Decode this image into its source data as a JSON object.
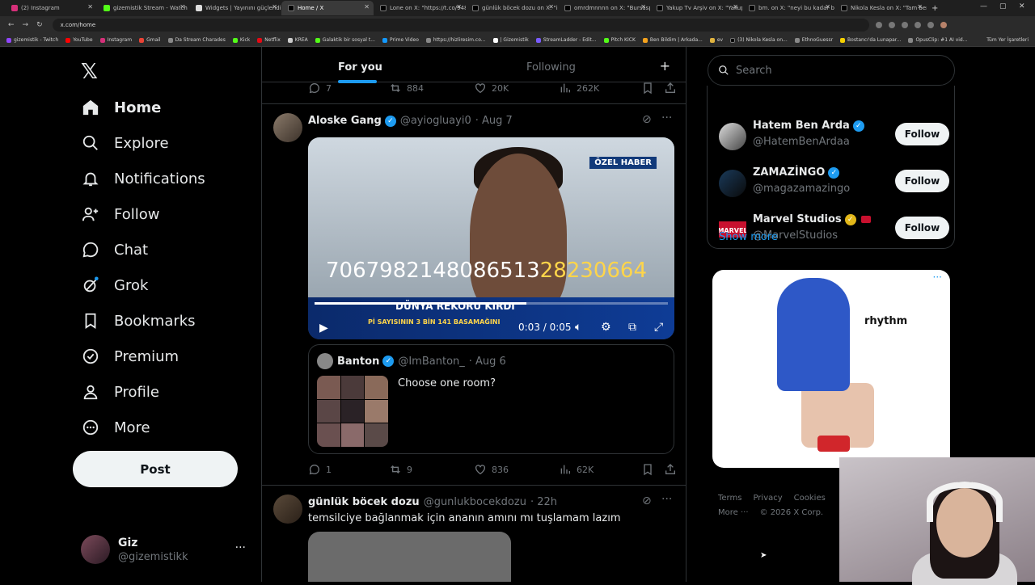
{
  "browser": {
    "tabs": [
      "(2) Instagram",
      "gizemistik Stream - Watch Li",
      "Widgets | Yayınını güçlendir",
      "Home / X",
      "Lone on X: \"https://t.co/948",
      "günlük böcek dozu on X: \"iny",
      "omrdmnnnn on X: \"Bursaspo",
      "Yakup Tv Arşiv on X: \"Yakup T",
      "bm. on X: \"neyi bu kadar büyü",
      "Nikola Kesla on X: \"Tam ben"
    ],
    "active_tab": 3,
    "url": "x.com/home",
    "bookmarks": [
      "gizemistik - Twitch",
      "YouTube",
      "Instagram",
      "Gmail",
      "Da Stream Charades",
      "Kick",
      "Netflix",
      "KREA",
      "Galaktik bir sosyal t...",
      "Prime Video",
      "https://hizliresim.co...",
      "| Gizemistik",
      "StreamLadder - Edit...",
      "Pitch KICK",
      "Ben Bildim | Arkada...",
      "ev",
      "(3) Nikola Kesla on...",
      "EthnoGuessr",
      "Bostancı'da Lunapar...",
      "OpusClip: #1 AI vid..."
    ],
    "bookmarks_right": "Tüm Yer İşaretleri"
  },
  "nav": {
    "items": [
      {
        "label": "Home",
        "icon": "home-icon"
      },
      {
        "label": "Explore",
        "icon": "search-icon"
      },
      {
        "label": "Notifications",
        "icon": "bell-icon"
      },
      {
        "label": "Follow",
        "icon": "follow-icon"
      },
      {
        "label": "Chat",
        "icon": "chat-icon"
      },
      {
        "label": "Grok",
        "icon": "grok-icon"
      },
      {
        "label": "Bookmarks",
        "icon": "bookmark-icon"
      },
      {
        "label": "Premium",
        "icon": "premium-icon"
      },
      {
        "label": "Profile",
        "icon": "profile-icon"
      },
      {
        "label": "More",
        "icon": "more-icon"
      }
    ],
    "post_label": "Post",
    "account": {
      "name": "Giz",
      "handle": "@gizemistikk"
    }
  },
  "feed": {
    "tabs": [
      "For you",
      "Following"
    ],
    "top_actions": {
      "replies": "7",
      "reposts": "884",
      "likes": "20K",
      "views": "262K"
    },
    "post1": {
      "name": "Aloske Gang",
      "handle": "@ayiogluayi0",
      "date": "· Aug 7",
      "video": {
        "badge": "ÖZEL HABER",
        "number_a": "7067982148086513",
        "number_b": "28230664",
        "headline": "DÜNYA REKORU KIRDI",
        "subline": "Pİ SAYISININ 3 BİN 141 BASAMAĞINI",
        "time": "0:03 / 0:05",
        "progress": 0.6
      },
      "quote": {
        "name": "Banton",
        "handle": "@ImBanton_",
        "date": "· Aug 6",
        "text": "Choose one room?"
      },
      "actions": {
        "replies": "1",
        "reposts": "9",
        "likes": "836",
        "views": "62K"
      }
    },
    "post2": {
      "name": "günlük böcek dozu",
      "handle": "@gunlukbocekdozu",
      "date": "· 22h",
      "text": "temsilciye bağlanmak için ananın amını mı tuşlamam lazım"
    }
  },
  "right": {
    "search_placeholder": "Search",
    "who_to_follow": [
      {
        "name": "Hatem Ben Arda",
        "handle": "@HatemBenArdaa",
        "button": "Follow"
      },
      {
        "name": "ZAMAZİNGO",
        "handle": "@magazamazingo",
        "button": "Follow"
      },
      {
        "name": "Marvel Studios",
        "handle": "@MarvelStudios",
        "button": "Follow"
      }
    ],
    "show_more": "Show more",
    "ad": {
      "brand": "rhythm",
      "menu": "···"
    },
    "footer": {
      "terms": "Terms",
      "privacy": "Privacy",
      "cookies": "Cookies",
      "more": "More ···",
      "copyright": "© 2026 X Corp."
    }
  },
  "colors": {
    "accent": "#1d9bf0",
    "background": "#000000",
    "border": "#2f3336",
    "muted": "#71767b"
  }
}
